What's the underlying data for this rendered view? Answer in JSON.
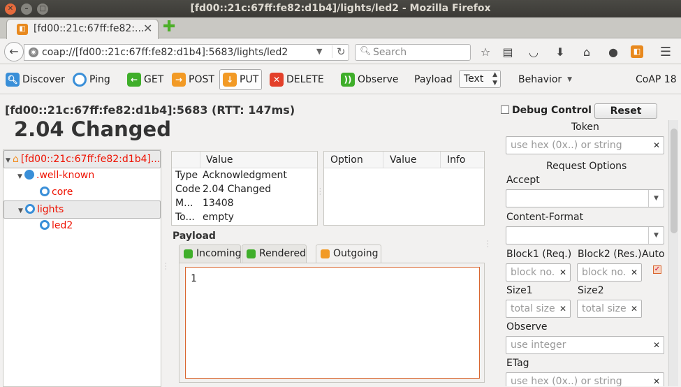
{
  "window": {
    "title": "[fd00::21c:67ff:fe82:d1b4]/lights/led2 - Mozilla Firefox"
  },
  "tab": {
    "title": "[fd00::21c:67ff:fe82:...",
    "close": "✕",
    "new": "✚"
  },
  "nav": {
    "url": "coap://[fd00::21c:67ff:fe82:d1b4]:5683/lights/led2",
    "search_placeholder": "Search"
  },
  "toolbar": {
    "discover": "Discover",
    "ping": "Ping",
    "get": "GET",
    "post": "POST",
    "put": "PUT",
    "delete": "DELETE",
    "observe": "Observe",
    "payload_label": "Payload",
    "payload_type": "Text",
    "behavior": "Behavior",
    "version": "CoAP 18"
  },
  "response": {
    "host": "[fd00::21c:67ff:fe82:d1b4]:5683 (RTT: 147ms)",
    "status": "2.04 Changed"
  },
  "tree": {
    "root": "[fd00::21c:67ff:fe82:d1b4]...",
    "well_known": ".well-known",
    "core": "core",
    "lights": "lights",
    "led2": "led2"
  },
  "message": {
    "header_value": "Value",
    "rows": [
      {
        "k": "Type",
        "v": "Acknowledgment"
      },
      {
        "k": "Code",
        "v": "2.04 Changed"
      },
      {
        "k": "M...",
        "v": "13408"
      },
      {
        "k": "To...",
        "v": "empty"
      }
    ]
  },
  "options": {
    "col_option": "Option",
    "col_value": "Value",
    "col_info": "Info"
  },
  "payload": {
    "label": "Payload",
    "tab_incoming": "Incoming",
    "tab_rendered": "Rendered",
    "tab_outgoing": "Outgoing",
    "content": "1"
  },
  "debug": {
    "label": "Debug Control",
    "reset": "Reset",
    "token": "Token",
    "token_placeholder": "use hex (0x..) or string",
    "request_options": "Request Options",
    "accept": "Accept",
    "content_format": "Content-Format",
    "block1": "Block1 (Req.)",
    "block2": "Block2 (Res.)",
    "auto": "Auto",
    "block_placeholder": "block no.",
    "size1": "Size1",
    "size2": "Size2",
    "size_placeholder": "total size",
    "observe": "Observe",
    "observe_placeholder": "use integer",
    "etag": "ETag",
    "etag_placeholder": "use hex (0x..) or string"
  }
}
